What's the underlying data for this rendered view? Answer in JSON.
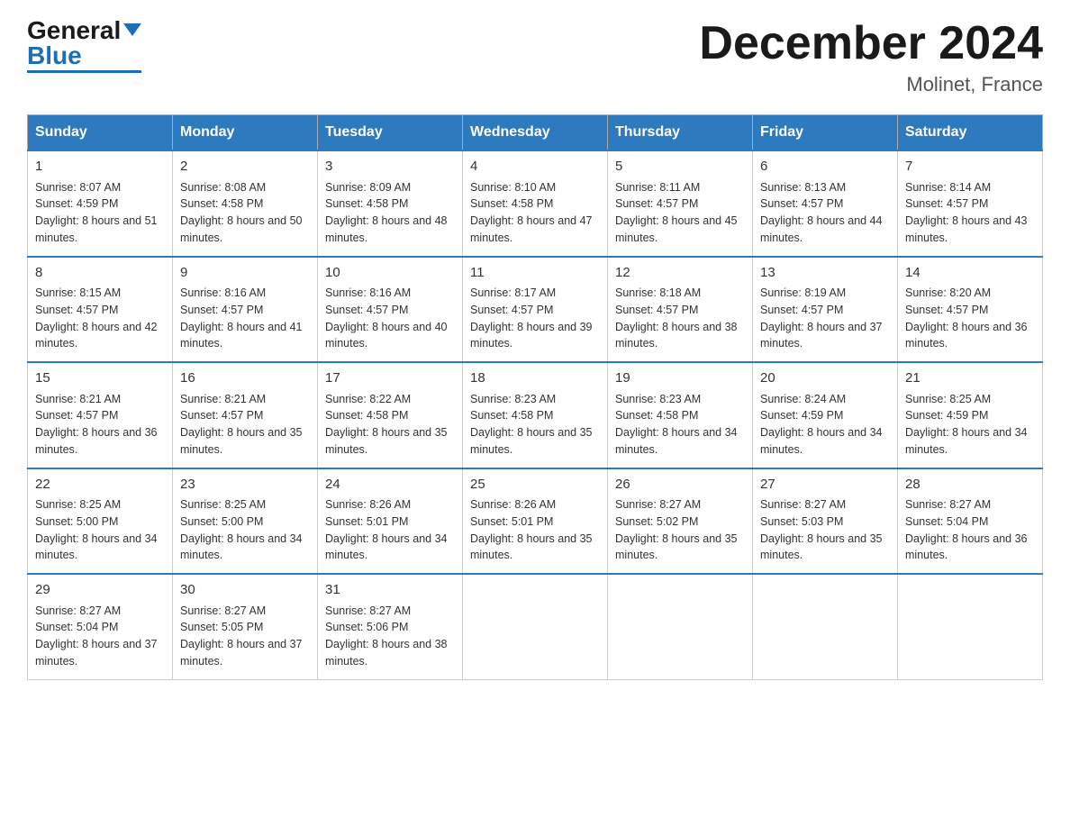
{
  "header": {
    "logo_general": "General",
    "logo_blue": "Blue",
    "month_title": "December 2024",
    "location": "Molinet, France"
  },
  "days_of_week": [
    "Sunday",
    "Monday",
    "Tuesday",
    "Wednesday",
    "Thursday",
    "Friday",
    "Saturday"
  ],
  "weeks": [
    [
      {
        "day": "1",
        "sunrise": "8:07 AM",
        "sunset": "4:59 PM",
        "daylight": "8 hours and 51 minutes."
      },
      {
        "day": "2",
        "sunrise": "8:08 AM",
        "sunset": "4:58 PM",
        "daylight": "8 hours and 50 minutes."
      },
      {
        "day": "3",
        "sunrise": "8:09 AM",
        "sunset": "4:58 PM",
        "daylight": "8 hours and 48 minutes."
      },
      {
        "day": "4",
        "sunrise": "8:10 AM",
        "sunset": "4:58 PM",
        "daylight": "8 hours and 47 minutes."
      },
      {
        "day": "5",
        "sunrise": "8:11 AM",
        "sunset": "4:57 PM",
        "daylight": "8 hours and 45 minutes."
      },
      {
        "day": "6",
        "sunrise": "8:13 AM",
        "sunset": "4:57 PM",
        "daylight": "8 hours and 44 minutes."
      },
      {
        "day": "7",
        "sunrise": "8:14 AM",
        "sunset": "4:57 PM",
        "daylight": "8 hours and 43 minutes."
      }
    ],
    [
      {
        "day": "8",
        "sunrise": "8:15 AM",
        "sunset": "4:57 PM",
        "daylight": "8 hours and 42 minutes."
      },
      {
        "day": "9",
        "sunrise": "8:16 AM",
        "sunset": "4:57 PM",
        "daylight": "8 hours and 41 minutes."
      },
      {
        "day": "10",
        "sunrise": "8:16 AM",
        "sunset": "4:57 PM",
        "daylight": "8 hours and 40 minutes."
      },
      {
        "day": "11",
        "sunrise": "8:17 AM",
        "sunset": "4:57 PM",
        "daylight": "8 hours and 39 minutes."
      },
      {
        "day": "12",
        "sunrise": "8:18 AM",
        "sunset": "4:57 PM",
        "daylight": "8 hours and 38 minutes."
      },
      {
        "day": "13",
        "sunrise": "8:19 AM",
        "sunset": "4:57 PM",
        "daylight": "8 hours and 37 minutes."
      },
      {
        "day": "14",
        "sunrise": "8:20 AM",
        "sunset": "4:57 PM",
        "daylight": "8 hours and 36 minutes."
      }
    ],
    [
      {
        "day": "15",
        "sunrise": "8:21 AM",
        "sunset": "4:57 PM",
        "daylight": "8 hours and 36 minutes."
      },
      {
        "day": "16",
        "sunrise": "8:21 AM",
        "sunset": "4:57 PM",
        "daylight": "8 hours and 35 minutes."
      },
      {
        "day": "17",
        "sunrise": "8:22 AM",
        "sunset": "4:58 PM",
        "daylight": "8 hours and 35 minutes."
      },
      {
        "day": "18",
        "sunrise": "8:23 AM",
        "sunset": "4:58 PM",
        "daylight": "8 hours and 35 minutes."
      },
      {
        "day": "19",
        "sunrise": "8:23 AM",
        "sunset": "4:58 PM",
        "daylight": "8 hours and 34 minutes."
      },
      {
        "day": "20",
        "sunrise": "8:24 AM",
        "sunset": "4:59 PM",
        "daylight": "8 hours and 34 minutes."
      },
      {
        "day": "21",
        "sunrise": "8:25 AM",
        "sunset": "4:59 PM",
        "daylight": "8 hours and 34 minutes."
      }
    ],
    [
      {
        "day": "22",
        "sunrise": "8:25 AM",
        "sunset": "5:00 PM",
        "daylight": "8 hours and 34 minutes."
      },
      {
        "day": "23",
        "sunrise": "8:25 AM",
        "sunset": "5:00 PM",
        "daylight": "8 hours and 34 minutes."
      },
      {
        "day": "24",
        "sunrise": "8:26 AM",
        "sunset": "5:01 PM",
        "daylight": "8 hours and 34 minutes."
      },
      {
        "day": "25",
        "sunrise": "8:26 AM",
        "sunset": "5:01 PM",
        "daylight": "8 hours and 35 minutes."
      },
      {
        "day": "26",
        "sunrise": "8:27 AM",
        "sunset": "5:02 PM",
        "daylight": "8 hours and 35 minutes."
      },
      {
        "day": "27",
        "sunrise": "8:27 AM",
        "sunset": "5:03 PM",
        "daylight": "8 hours and 35 minutes."
      },
      {
        "day": "28",
        "sunrise": "8:27 AM",
        "sunset": "5:04 PM",
        "daylight": "8 hours and 36 minutes."
      }
    ],
    [
      {
        "day": "29",
        "sunrise": "8:27 AM",
        "sunset": "5:04 PM",
        "daylight": "8 hours and 37 minutes."
      },
      {
        "day": "30",
        "sunrise": "8:27 AM",
        "sunset": "5:05 PM",
        "daylight": "8 hours and 37 minutes."
      },
      {
        "day": "31",
        "sunrise": "8:27 AM",
        "sunset": "5:06 PM",
        "daylight": "8 hours and 38 minutes."
      },
      null,
      null,
      null,
      null
    ]
  ]
}
